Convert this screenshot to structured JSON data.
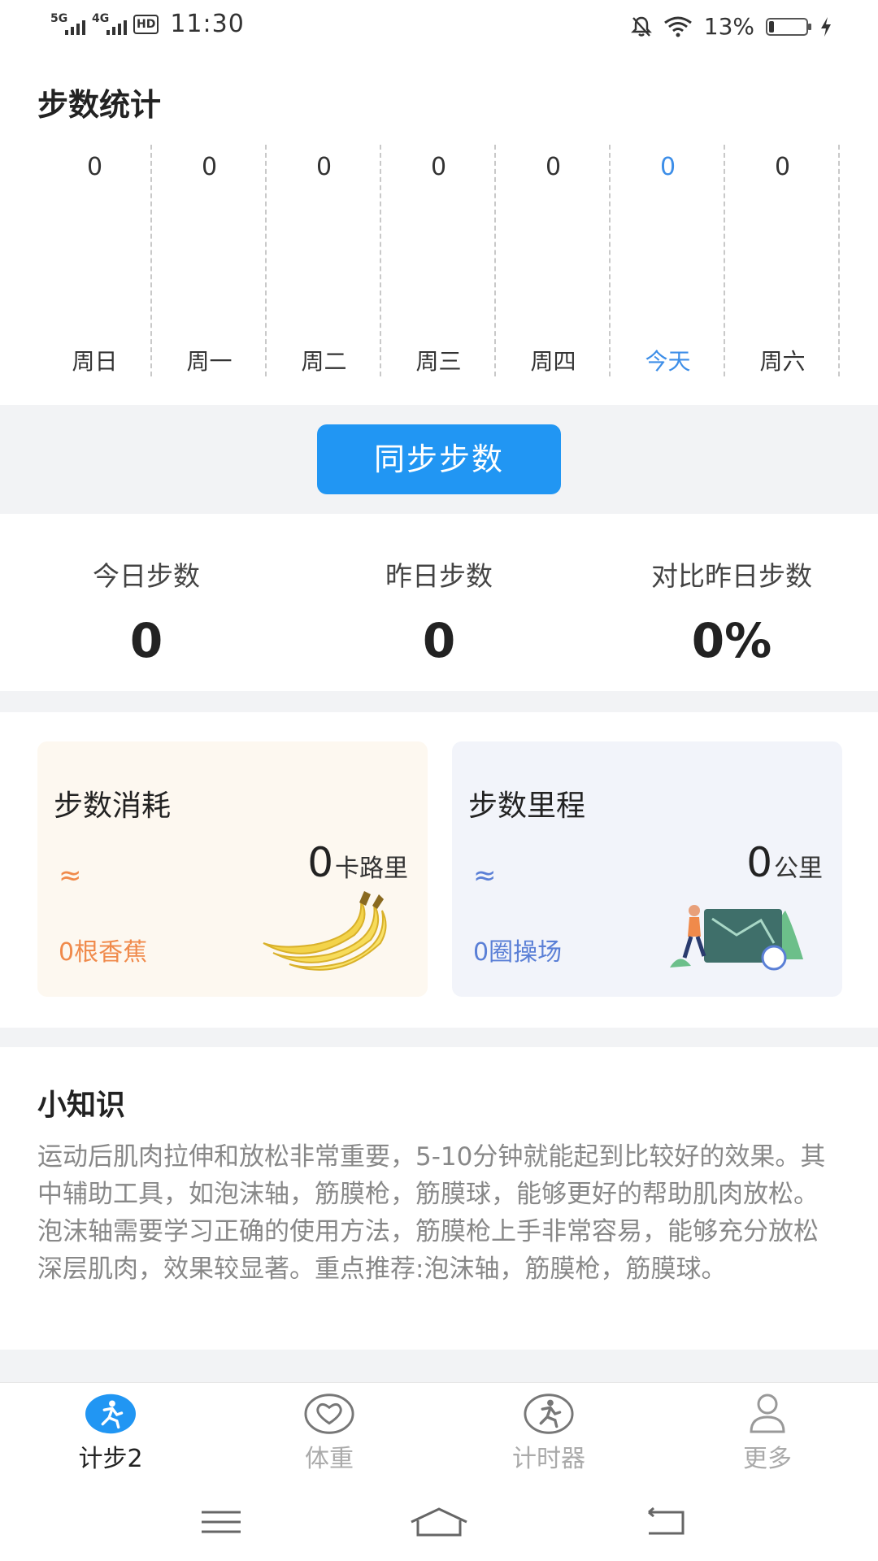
{
  "status_bar": {
    "net1": "5G",
    "net2": "4G",
    "hd": "HD",
    "time": "11:30",
    "battery_pct": "13%"
  },
  "page_title": "步数统计",
  "week": [
    {
      "label": "周日",
      "value": "0",
      "active": false
    },
    {
      "label": "周一",
      "value": "0",
      "active": false
    },
    {
      "label": "周二",
      "value": "0",
      "active": false
    },
    {
      "label": "周三",
      "value": "0",
      "active": false
    },
    {
      "label": "周四",
      "value": "0",
      "active": false
    },
    {
      "label": "今天",
      "value": "0",
      "active": true
    },
    {
      "label": "周六",
      "value": "0",
      "active": false
    }
  ],
  "sync_button": "同步步数",
  "stats": [
    {
      "label": "今日步数",
      "value": "0"
    },
    {
      "label": "昨日步数",
      "value": "0"
    },
    {
      "label": "对比昨日步数",
      "value": "0%"
    }
  ],
  "cards": {
    "calories": {
      "title": "步数消耗",
      "number": "0",
      "unit": "卡路里",
      "approx": "≈",
      "equivalent": "0根香蕉",
      "illustration": "banana-icon"
    },
    "distance": {
      "title": "步数里程",
      "number": "0",
      "unit": "公里",
      "approx": "≈",
      "equivalent": "0圈操场",
      "illustration": "runner-map-icon"
    }
  },
  "tips": {
    "title": "小知识",
    "body": "运动后肌肉拉伸和放松非常重要，5-10分钟就能起到比较好的效果。其中辅助工具，如泡沫轴，筋膜枪，筋膜球，能够更好的帮助肌肉放松。泡沫轴需要学习正确的使用方法，筋膜枪上手非常容易，能够充分放松深层肌肉，效果较显著。重点推荐:泡沫轴，筋膜枪，筋膜球。"
  },
  "tabs": [
    {
      "label": "计步2",
      "icon": "runner-icon",
      "active": true
    },
    {
      "label": "体重",
      "icon": "heart-icon",
      "active": false
    },
    {
      "label": "计时器",
      "icon": "timer-runner-icon",
      "active": false
    },
    {
      "label": "更多",
      "icon": "person-icon",
      "active": false
    }
  ],
  "colors": {
    "accent": "#2196f3",
    "today": "#3d8ee8",
    "calories_accent": "#f08a4b",
    "distance_accent": "#5a7fd6"
  }
}
